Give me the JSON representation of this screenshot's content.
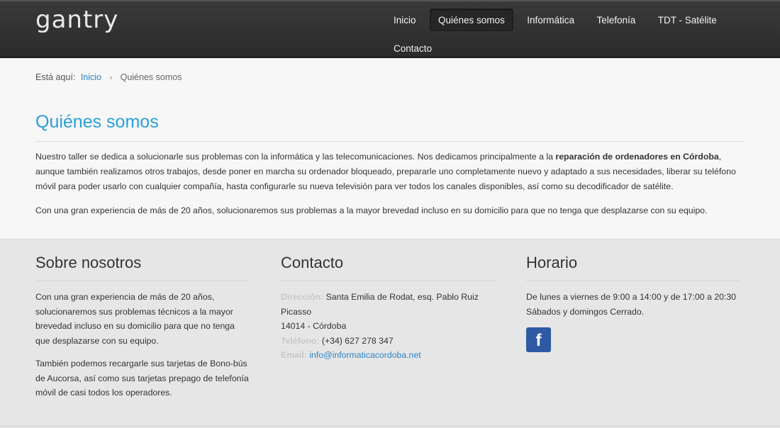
{
  "header": {
    "logo": "gantry",
    "nav": [
      {
        "label": "Inicio"
      },
      {
        "label": "Quiénes somos"
      },
      {
        "label": "Informática"
      },
      {
        "label": "Telefonía"
      },
      {
        "label": "TDT - Satélite"
      },
      {
        "label": "Contacto"
      }
    ],
    "active_index": 1
  },
  "breadcrumb": {
    "prefix": "Está aquí:",
    "home": "Inicio",
    "separator": "›",
    "current": "Quiénes somos"
  },
  "main": {
    "title": "Quiénes somos",
    "p1_a": "Nuestro taller se dedica a solucionarle sus problemas con la informática y las telecomunicaciones. Nos dedicamos principalmente a la ",
    "p1_bold": "reparación de ordenadores en Córdoba",
    "p1_b": ", aunque también realizamos otros trabajos, desde poner en marcha su ordenador bloqueado, prepararle uno completamente nuevo y adaptado a sus necesidades, liberar su teléfono móvil para poder usarlo con cualquier compañía, hasta configurarle su nueva televisión para ver todos los canales disponibles, así como su decodificador de satélite.",
    "p2": "Con una gran experiencia de más de 20 años, solucionaremos sus problemas a la mayor brevedad incluso en su domicilio para que no tenga que desplazarse con su equipo."
  },
  "footer": {
    "about": {
      "title": "Sobre nosotros",
      "p1": "Con una gran experiencia de más de 20 años, solucionaremos sus problemas técnicos a la mayor brevedad incluso en su domicilio para que no tenga que desplazarse con su equipo.",
      "p2": "También podemos recargarle sus tarjetas de Bono-bús de Aucorsa, así como sus tarjetas prepago de telefonía móvil de casi todos los operadores."
    },
    "contact": {
      "title": "Contacto",
      "address_label": "Dirección:",
      "address": "Santa Emilia de Rodat, esq. Pablo Ruiz Picasso",
      "city": "14014 - Córdoba",
      "phone_label": "Teléfono:",
      "phone": "(+34) 627 278 347",
      "email_label": "Email:",
      "email": "info@informaticacordoba.net"
    },
    "hours": {
      "title": "Horario",
      "line1": "De lunes a viernes de 9:00 a 14:00 y de 17:00 a 20:30",
      "line2": "Sábados y domingos Cerrado.",
      "facebook_glyph": "f"
    }
  },
  "colors": {
    "accent": "#2a9fd6",
    "link": "#2a84c6",
    "facebook": "#2f5aa3"
  }
}
